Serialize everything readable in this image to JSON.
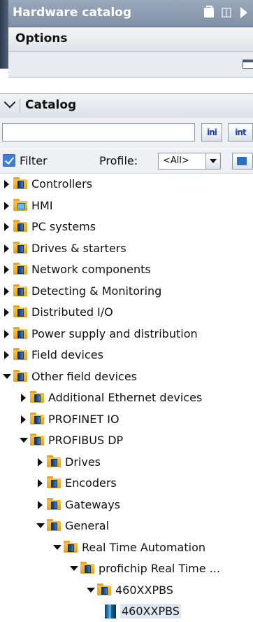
{
  "panel": {
    "title": "Hardware catalog",
    "options_label": "Options",
    "catalog_label": "Catalog"
  },
  "search": {
    "value": "",
    "placeholder": "",
    "search_down_label": "ini",
    "search_up_label": "int"
  },
  "filter": {
    "filter_label": "Filter",
    "filter_checked": true,
    "profile_label": "Profile:",
    "profile_value": "<All>"
  },
  "tree": [
    {
      "label": "Controllers",
      "depth": 0,
      "state": "collapsed",
      "icon": "folder-device-icon"
    },
    {
      "label": "HMI",
      "depth": 0,
      "state": "collapsed",
      "icon": "folder-hmi-icon"
    },
    {
      "label": "PC systems",
      "depth": 0,
      "state": "collapsed",
      "icon": "folder-device-icon"
    },
    {
      "label": "Drives & starters",
      "depth": 0,
      "state": "collapsed",
      "icon": "folder-device-icon"
    },
    {
      "label": "Network components",
      "depth": 0,
      "state": "collapsed",
      "icon": "folder-device-icon"
    },
    {
      "label": "Detecting & Monitoring",
      "depth": 0,
      "state": "collapsed",
      "icon": "folder-device-icon"
    },
    {
      "label": "Distributed I/O",
      "depth": 0,
      "state": "collapsed",
      "icon": "folder-device-icon"
    },
    {
      "label": "Power supply and distribution",
      "depth": 0,
      "state": "collapsed",
      "icon": "folder-device-icon"
    },
    {
      "label": "Field devices",
      "depth": 0,
      "state": "collapsed",
      "icon": "folder-device-icon"
    },
    {
      "label": "Other field devices",
      "depth": 0,
      "state": "expanded",
      "icon": "folder-device-icon"
    },
    {
      "label": "Additional Ethernet devices",
      "depth": 1,
      "state": "collapsed",
      "icon": "folder-device-icon"
    },
    {
      "label": "PROFINET IO",
      "depth": 1,
      "state": "collapsed",
      "icon": "folder-device-icon"
    },
    {
      "label": "PROFIBUS DP",
      "depth": 1,
      "state": "expanded",
      "icon": "folder-device-icon"
    },
    {
      "label": "Drives",
      "depth": 2,
      "state": "collapsed",
      "icon": "folder-device-icon"
    },
    {
      "label": "Encoders",
      "depth": 2,
      "state": "collapsed",
      "icon": "folder-device-icon"
    },
    {
      "label": "Gateways",
      "depth": 2,
      "state": "collapsed",
      "icon": "folder-device-icon"
    },
    {
      "label": "General",
      "depth": 2,
      "state": "expanded",
      "icon": "folder-device-icon"
    },
    {
      "label": "Real Time Automation",
      "depth": 3,
      "state": "expanded",
      "icon": "folder-device-icon"
    },
    {
      "label": "profichip Real Time ...",
      "depth": 4,
      "state": "expanded",
      "icon": "folder-device-icon"
    },
    {
      "label": "460XXPBS",
      "depth": 5,
      "state": "expanded",
      "icon": "folder-device-icon"
    },
    {
      "label": "460XXPBS",
      "depth": 6,
      "state": "leaf",
      "icon": "device-module-icon",
      "selected": true
    }
  ]
}
